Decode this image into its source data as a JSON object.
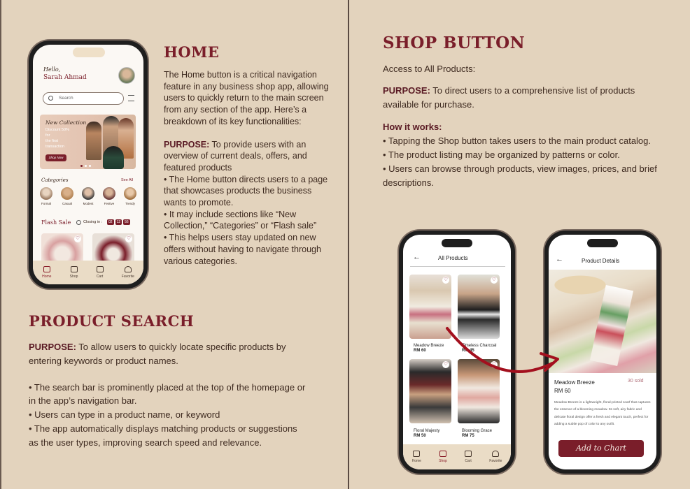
{
  "home_section": {
    "heading": "HOME",
    "intro": "The Home button is a critical navigation feature in any business shop app, allowing users to quickly return to the main screen from any section of the app. Here’s a breakdown of its key functionalities:",
    "purpose_label": "PURPOSE:",
    "purpose_text": " To provide users with an overview of current deals, offers, and featured products",
    "bullets": [
      "• The Home button directs users to a page that showcases products the business wants to promote.",
      "• It may include sections like “New Collection,” “Categories” or “Flash sale”",
      "• This helps users stay updated on new offers without having to navigate through various categories."
    ]
  },
  "search_section": {
    "heading": "PRODUCT SEARCH",
    "purpose_label": "PURPOSE:",
    "purpose_text": " To allow users to quickly locate specific products by entering keywords or product names.",
    "bullets": [
      "• The search bar is prominently placed at the top of the homepage or in the app’s navigation bar.",
      "• Users can type in a product name, or keyword",
      "• The app automatically displays matching products or suggestions as the user types, improving search speed and relevance."
    ]
  },
  "shop_section": {
    "heading": "SHOP BUTTON",
    "intro": "Access to All Products:",
    "purpose_label": "PURPOSE:",
    "purpose_text": " To direct users to a comprehensive list of products available for purchase.",
    "how_label": "How it works:",
    "bullets": [
      "• Tapping the Shop button takes users to the main product catalog.",
      "• The product listing may be organized by patterns or color.",
      "• Users can browse through products, view images, prices, and brief descriptions."
    ]
  },
  "home_phone": {
    "greeting": "Hello,",
    "user_name": "Sarah Ahmad",
    "search_placeholder": "Search",
    "banner_title": "New Collection",
    "banner_line1": "Discount 50%",
    "banner_line2": "for",
    "banner_line3": "the first",
    "banner_line4": "transaction",
    "banner_button": "Shop Now",
    "categories_title": "Categories",
    "see_all": "See All",
    "categories": [
      "Formal",
      "Casual",
      "Modest",
      "Festive",
      "Trendy"
    ],
    "flash_sale": "Flash Sale",
    "closing_in": "Closing in :",
    "timer": [
      "02",
      "12",
      "56"
    ],
    "nav": [
      "Home",
      "Shop",
      "Cart",
      "Favorite"
    ]
  },
  "all_products_phone": {
    "title": "All Products",
    "products": [
      {
        "name": "Meadow Breeze",
        "price": "RM 60"
      },
      {
        "name": "Timeless Charcoal",
        "price": "RM 45"
      },
      {
        "name": "Floral Majesty",
        "price": "RM 50"
      },
      {
        "name": "Blooming Grace",
        "price": "RM 75"
      }
    ],
    "nav": [
      "Home",
      "Shop",
      "Cart",
      "Favorite"
    ]
  },
  "details_phone": {
    "title": "Product Details",
    "product_name": "Meadow Breeze",
    "sold": "30 sold",
    "price": "RM 60",
    "description": "Meadow Breeze is a lightweight, floral-printed scarf that captures the essence of a blooming meadow. Its soft, airy fabric and delicate floral design offer a fresh and elegant touch, perfect for adding a subtle pop of color to any outfit.",
    "cta": "Add to Chart"
  },
  "colors": {
    "background": "#e3d3bd",
    "accent": "#7a1e2a",
    "cta": "#7a1e2a"
  }
}
